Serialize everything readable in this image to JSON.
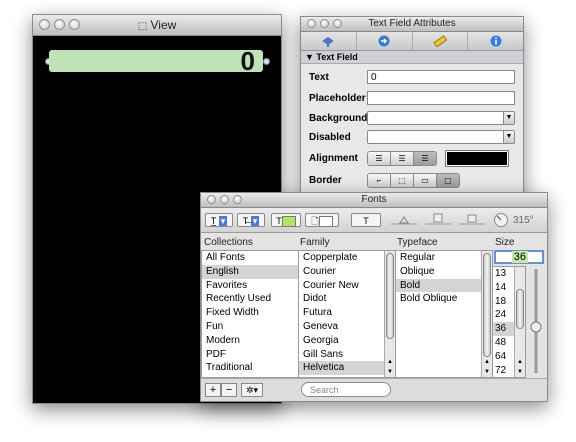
{
  "view_window": {
    "title": "View",
    "field_value": "0"
  },
  "attr_window": {
    "title": "Text Field Attributes",
    "tabs": [
      "attributes-icon",
      "connections-icon",
      "size-icon",
      "identity-icon"
    ],
    "section": "▼ Text Field",
    "rows": {
      "text_label": "Text",
      "text_value": "0",
      "placeholder_label": "Placeholder",
      "background_label": "Background",
      "disabled_label": "Disabled",
      "alignment_label": "Alignment",
      "border_label": "Border"
    },
    "text_color": "#000000"
  },
  "fonts_window": {
    "title": "Fonts",
    "angle": "315°",
    "headers": {
      "collections": "Collections",
      "family": "Family",
      "typeface": "Typeface",
      "size": "Size"
    },
    "collections": [
      "All Fonts",
      "English",
      "Favorites",
      "Recently Used",
      "Fixed Width",
      "Fun",
      "Modern",
      "PDF",
      "Traditional"
    ],
    "families": [
      "Copperplate",
      "Courier",
      "Courier New",
      "Didot",
      "Futura",
      "Geneva",
      "Georgia",
      "Gill Sans",
      "Helvetica"
    ],
    "typefaces": [
      "Regular",
      "Oblique",
      "Bold",
      "Bold Oblique"
    ],
    "size_value": "36",
    "sizes": [
      "13",
      "14",
      "18",
      "24",
      "36",
      "48",
      "64",
      "72"
    ],
    "selected_collection": "English",
    "selected_family": "Helvetica",
    "selected_typeface": "Bold",
    "selected_size": "36",
    "search_placeholder": "Search",
    "add_label": "+",
    "remove_label": "−",
    "action_label": "✲▾"
  }
}
